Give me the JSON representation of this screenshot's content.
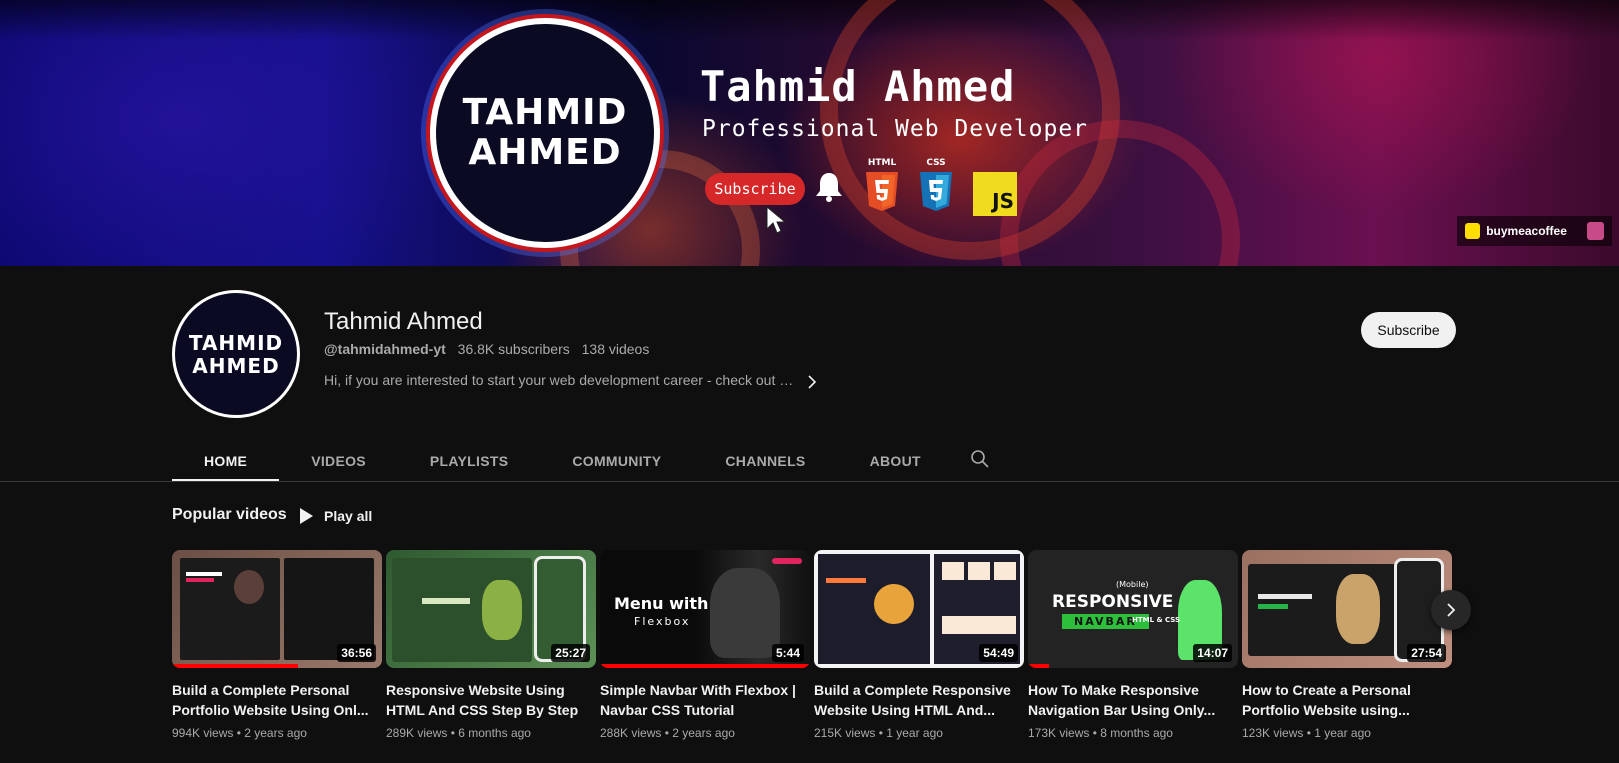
{
  "banner": {
    "logo_line1": "TAHMID",
    "logo_line2": "AHMED",
    "name": "Tahmid Ahmed",
    "tagline": "Professional Web Developer",
    "subscribe_label": "Subscribe",
    "html_badge": "HTML",
    "css_badge": "CSS",
    "js_badge": "JS",
    "link_label": "buymeacoffee"
  },
  "channel": {
    "avatar_line1": "TAHMID",
    "avatar_line2": "AHMED",
    "name": "Tahmid Ahmed",
    "handle": "@tahmidahmed-yt",
    "subscribers": "36.8K subscribers",
    "videos": "138 videos",
    "description": "Hi, if you are interested to start your web development career - check out t...",
    "subscribe_label": "Subscribe"
  },
  "tabs": [
    {
      "label": "HOME",
      "active": true
    },
    {
      "label": "VIDEOS"
    },
    {
      "label": "PLAYLISTS"
    },
    {
      "label": "COMMUNITY"
    },
    {
      "label": "CHANNELS"
    },
    {
      "label": "ABOUT"
    }
  ],
  "popular": {
    "title": "Popular videos",
    "play_all": "Play all",
    "videos": [
      {
        "title": "Build a Complete Personal Portfolio Website Using Onl...",
        "views": "994K views",
        "age": "2 years ago",
        "duration": "36:56",
        "progress": 0.6,
        "thumb_color": "#8a6a5e"
      },
      {
        "title": "Responsive Website Using HTML And CSS Step By Step",
        "views": "289K views",
        "age": "6 months ago",
        "duration": "25:27",
        "progress": 0,
        "thumb_color": "#3a6b3c"
      },
      {
        "title": "Simple Navbar With Flexbox | Navbar CSS Tutorial",
        "views": "288K views",
        "age": "2 years ago",
        "duration": "5:44",
        "progress": 1.0,
        "thumb_color": "#111111",
        "overlay_line1": "Menu with",
        "overlay_line2": "Flexbox"
      },
      {
        "title": "Build a Complete Responsive Website Using HTML And...",
        "views": "215K views",
        "age": "1 year ago",
        "duration": "54:49",
        "progress": 0,
        "thumb_color": "#1c1c2a"
      },
      {
        "title": "How To Make Responsive Navigation Bar Using Only...",
        "views": "173K views",
        "age": "8 months ago",
        "duration": "14:07",
        "progress": 0.1,
        "thumb_color": "#2a2a2a",
        "overlay_line1": "RESPONSIVE",
        "overlay_line2": "NAVBAR",
        "overlay_line3": "HTML & CSS",
        "overlay_line4": "(Mobile)"
      },
      {
        "title": "How to Create a Personal Portfolio Website using...",
        "views": "123K views",
        "age": "1 year ago",
        "duration": "27:54",
        "progress": 0,
        "thumb_color": "#a07a68"
      }
    ]
  },
  "colors": {
    "background": "#0f0f0f",
    "text_primary": "#f1f1f1",
    "text_secondary": "#aaaaaa",
    "progress_red": "#ff0000"
  }
}
